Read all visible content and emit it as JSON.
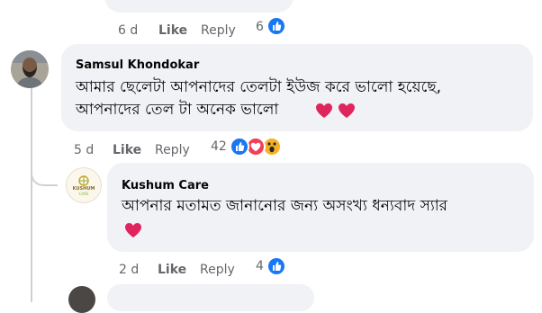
{
  "previous_comment": {
    "time": "6 d",
    "like_label": "Like",
    "reply_label": "Reply",
    "reaction_count": "6",
    "reactions": [
      "like-icon"
    ]
  },
  "comment": {
    "author": "Samsul Khondokar",
    "text_line1": "আমার ছেলেটা আপনাদের তেলটা ইউজ করে ভালো হয়েছে,",
    "text_line2": "আপনাদের তেল টা অনেক ভালো",
    "emoji": [
      "heart-emoji",
      "heart-emoji"
    ],
    "time": "5 d",
    "like_label": "Like",
    "reply_label": "Reply",
    "reaction_count": "42",
    "reactions": [
      "like-icon",
      "love-icon",
      "wow-icon"
    ]
  },
  "reply": {
    "author": "Kushum Care",
    "text_line1": "আপনার মতামত জানানোর জন্য অসংখ্য ধন্যবাদ স্যার",
    "emoji": [
      "heart-emoji"
    ],
    "logo_text_1": "KUSHUM",
    "logo_text_2": "CARE",
    "time": "2 d",
    "like_label": "Like",
    "reply_label": "Reply",
    "reaction_count": "4",
    "reactions": [
      "like-icon"
    ]
  },
  "colors": {
    "bubble": "#f0f2f5",
    "meta_text": "#65676b",
    "like_blue": "#1877f2",
    "love_red": "#f33e58",
    "wow_yellow": "#f7b125",
    "heart_pink": "#e0245e"
  }
}
